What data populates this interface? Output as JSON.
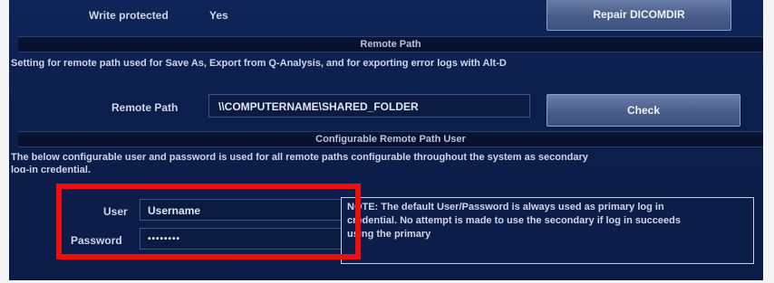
{
  "top": {
    "write_protected_label": "Write protected",
    "write_protected_value": "Yes",
    "repair_button": "Repair DICOMDIR"
  },
  "remote_path_section": {
    "header": "Remote Path",
    "description": "Setting for remote path used for Save As, Export from Q-Analysis, and for exporting error logs with Alt-D",
    "label": "Remote Path",
    "value": "\\\\COMPUTERNAME\\SHARED_FOLDER",
    "check_button": "Check"
  },
  "remote_user_section": {
    "header": "Configurable Remote Path User",
    "description_line1": "The below configurable user and password is used for all remote paths configurable throughout the system as secondary",
    "description_line2": "log-in credential.",
    "user_label": "User",
    "user_value": "Username",
    "password_label": "Password",
    "password_value": "••••••••",
    "note_line1": "NOTE: The default User/Password is always used as primary log in",
    "note_line2": "credential. No attempt is made to use the secondary if log in succeeds",
    "note_line3": "using the primary"
  },
  "colors": {
    "panel_bg": "#0c1e4b",
    "button_bg": "#4a5d89",
    "highlight": "#f20d0d"
  }
}
